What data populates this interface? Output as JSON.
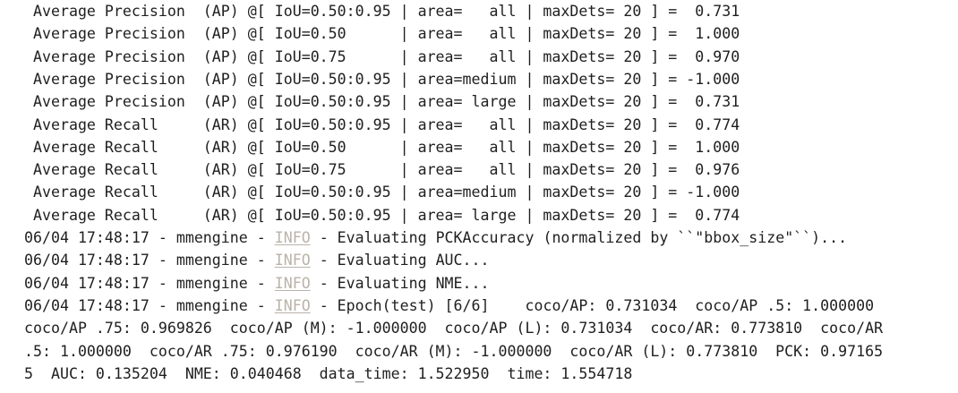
{
  "eval_lines": [
    " Average Precision  (AP) @[ IoU=0.50:0.95 | area=   all | maxDets= 20 ] =  0.731",
    " Average Precision  (AP) @[ IoU=0.50      | area=   all | maxDets= 20 ] =  1.000",
    " Average Precision  (AP) @[ IoU=0.75      | area=   all | maxDets= 20 ] =  0.970",
    " Average Precision  (AP) @[ IoU=0.50:0.95 | area=medium | maxDets= 20 ] = -1.000",
    " Average Precision  (AP) @[ IoU=0.50:0.95 | area= large | maxDets= 20 ] =  0.731",
    " Average Recall     (AR) @[ IoU=0.50:0.95 | area=   all | maxDets= 20 ] =  0.774",
    " Average Recall     (AR) @[ IoU=0.50      | area=   all | maxDets= 20 ] =  1.000",
    " Average Recall     (AR) @[ IoU=0.75      | area=   all | maxDets= 20 ] =  0.976",
    " Average Recall     (AR) @[ IoU=0.50:0.95 | area=medium | maxDets= 20 ] = -1.000",
    " Average Recall     (AR) @[ IoU=0.50:0.95 | area= large | maxDets= 20 ] =  0.774"
  ],
  "log_lines": [
    {
      "prefix": "06/04 17:48:17 - mmengine - ",
      "level": "INFO",
      "message": " - Evaluating PCKAccuracy (normalized by ``\"bbox_size\"``)..."
    },
    {
      "prefix": "06/04 17:48:17 - mmengine - ",
      "level": "INFO",
      "message": " - Evaluating AUC..."
    },
    {
      "prefix": "06/04 17:48:17 - mmengine - ",
      "level": "INFO",
      "message": " - Evaluating NME..."
    },
    {
      "prefix": "06/04 17:48:17 - mmengine - ",
      "level": "INFO",
      "message": " - Epoch(test) [6/6]    coco/AP: 0.731034  coco/AP .5: 1.000000"
    }
  ],
  "wrap_lines": [
    "coco/AP .75: 0.969826  coco/AP (M): -1.000000  coco/AP (L): 0.731034  coco/AR: 0.773810  coco/AR",
    ".5: 1.000000  coco/AR .75: 0.976190  coco/AR (M): -1.000000  coco/AR (L): 0.773810  PCK: 0.97165",
    "5  AUC: 0.135204  NME: 0.040468  data_time: 1.522950  time: 1.554718"
  ]
}
